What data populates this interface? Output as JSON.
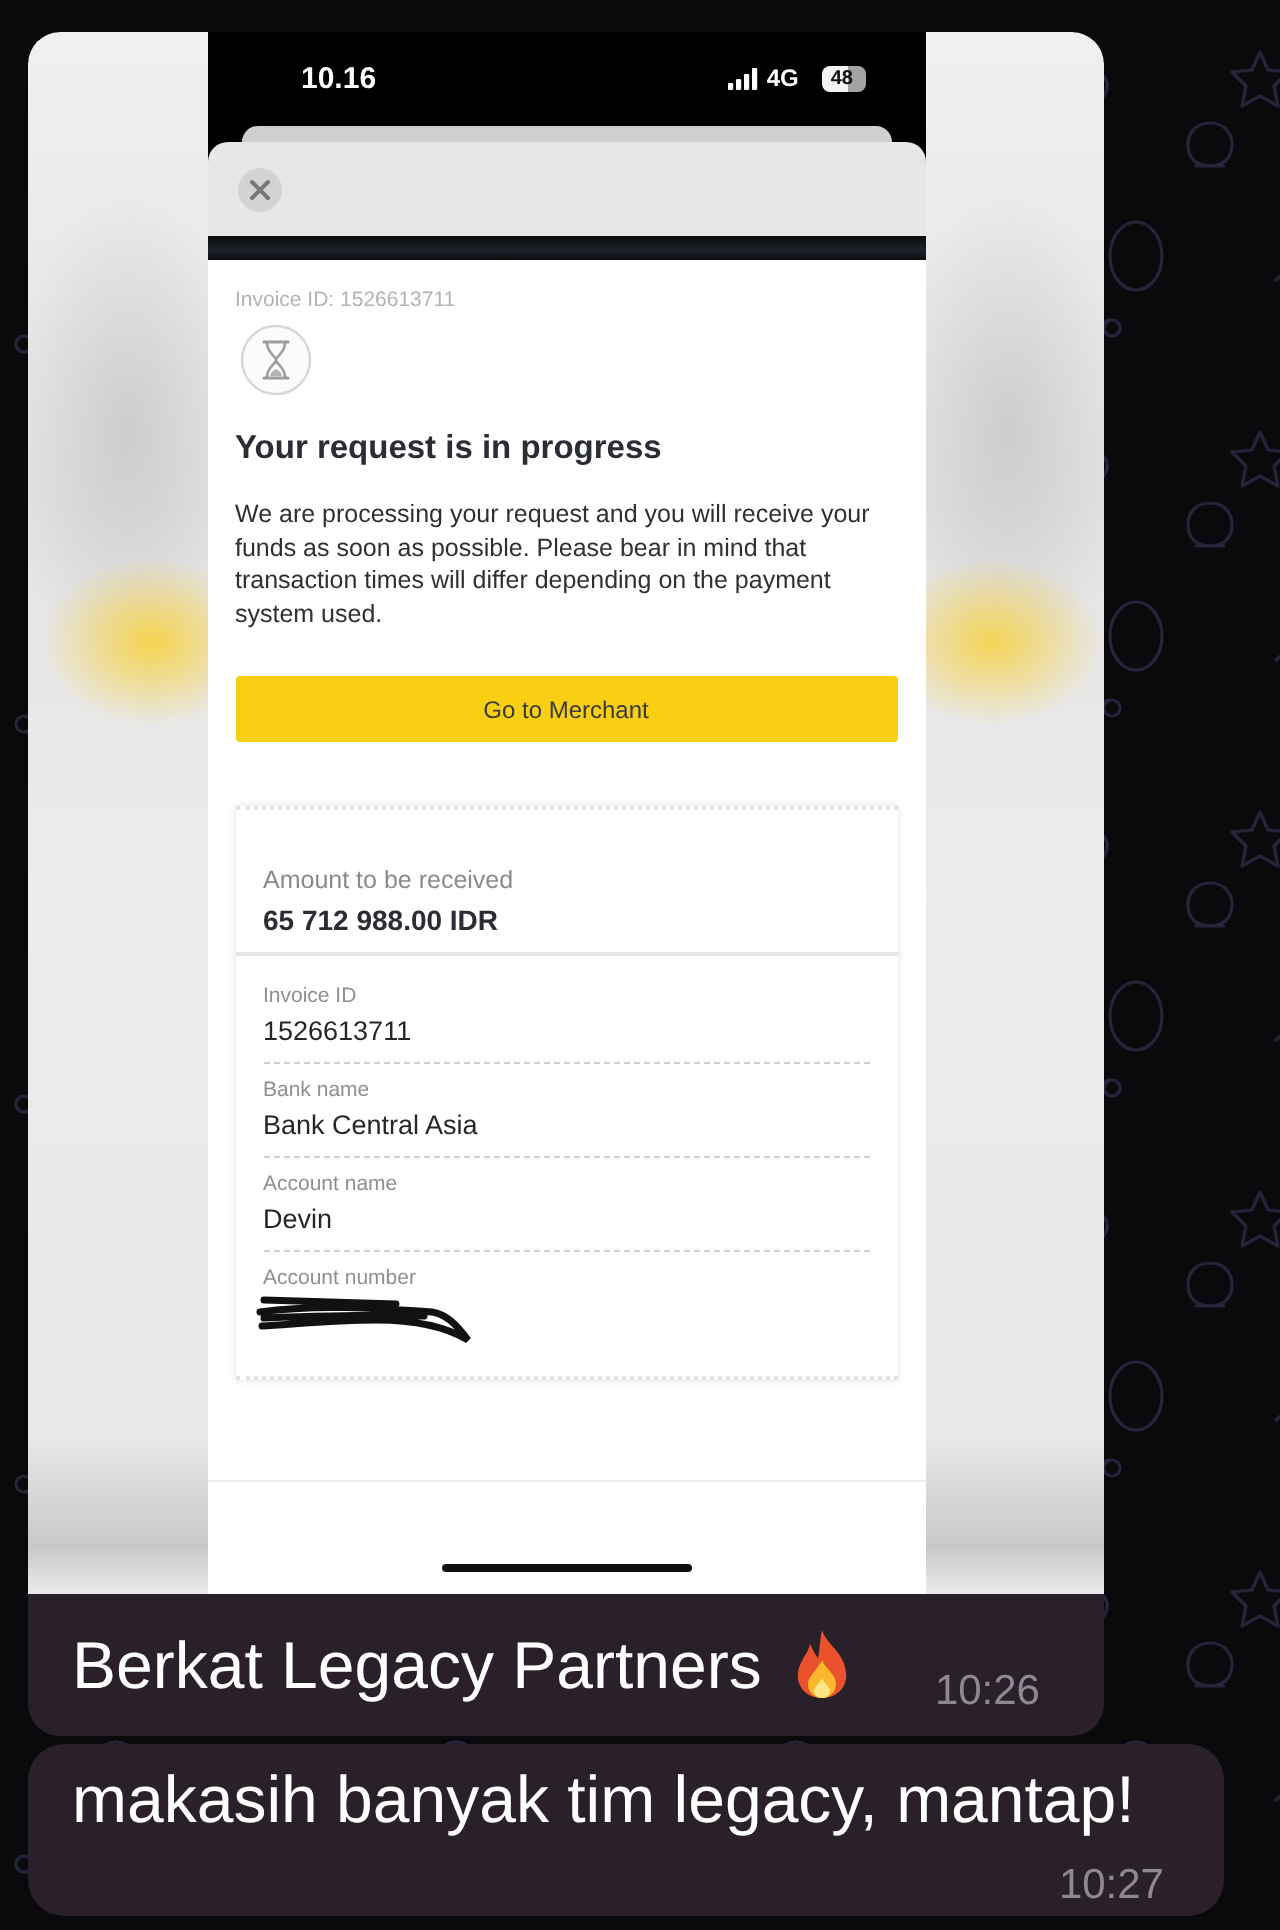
{
  "messages": [
    {
      "kind": "photo",
      "screenshot": {
        "status_bar": {
          "time": "10.16",
          "network": "4G",
          "battery": "48"
        },
        "invoice_caption": "Invoice ID: 1526613711",
        "title": "Your request is in progress",
        "message": "We are processing your request and you will receive your funds as soon as possible. Please bear in mind that transaction times will differ depending on the payment system used.",
        "merchant_button": "Go to Merchant",
        "summary": {
          "amount_label": "Amount to be received",
          "amount": "65 712 988.00 IDR",
          "fields": [
            {
              "label": "Invoice ID",
              "value": "1526613711",
              "redacted": false
            },
            {
              "label": "Bank name",
              "value": "Bank Central Asia",
              "redacted": false
            },
            {
              "label": "Account name",
              "value": "Devin",
              "redacted": false
            },
            {
              "label": "Account number",
              "redacted": true
            }
          ]
        }
      },
      "caption": "Berkat Legacy Partners",
      "emoji": true,
      "time": "10:26"
    },
    {
      "kind": "text",
      "text": "makasih banyak tim legacy, mantap!",
      "time": "10:27"
    }
  ]
}
